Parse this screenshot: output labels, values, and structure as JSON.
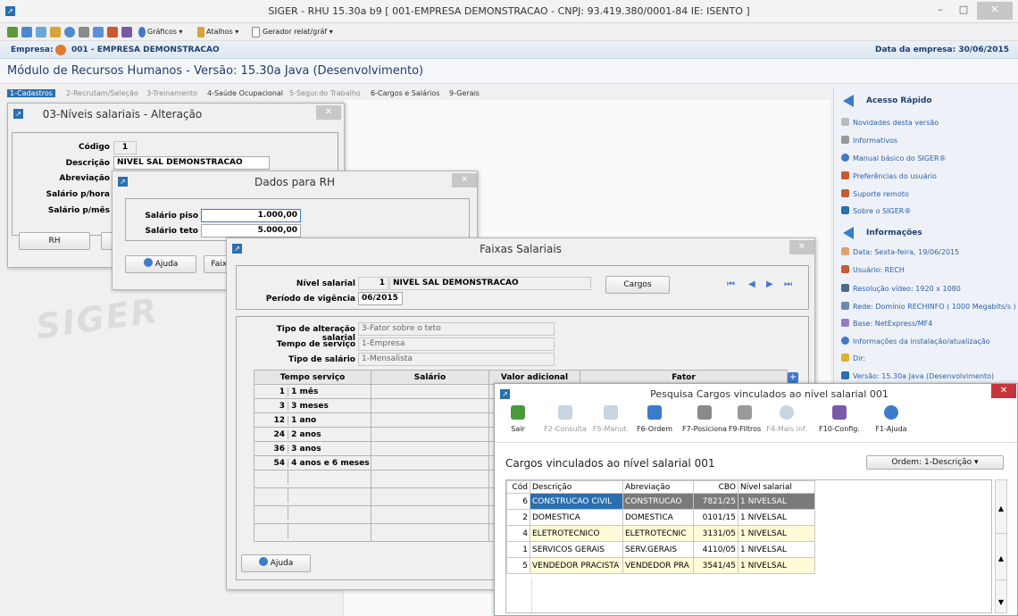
{
  "window": {
    "title": "SIGER - RHU 15.30a b9 [ 001-EMPRESA DEMONSTRACAO - CNPJ: 93.419.380/0001-84 IE: ISENTO ]",
    "minimize": "–",
    "maximize": "□",
    "close": "✕"
  },
  "toolbar": {
    "graficos": "Gráficos ▾",
    "atalhos": "Atalhos ▾",
    "gerador": "Gerador relat/gráf ▾"
  },
  "empresa": {
    "label": "Empresa:",
    "value": "001 - EMPRESA DEMONSTRACAO",
    "data_label": "Data da empresa: 30/06/2015"
  },
  "module": {
    "title": "Módulo de Recursos Humanos - Versão: 15.30a Java (Desenvolvimento)"
  },
  "menu": [
    "1-Cadastros",
    "2-Recrutam/Seleção",
    "3-Treinamento",
    "4-Saúde Ocupacional",
    "5-Segur.do Trabalho",
    "6-Cargos e Salários",
    "9-Gerais"
  ],
  "watermark": "SIGER",
  "niveis": {
    "title": "03-Níveis salariais - Alteração",
    "codigo_label": "Código",
    "codigo": "1",
    "descricao_label": "Descrição",
    "descricao": "NIVEL SAL DEMONSTRACAO",
    "abreviacao_label": "Abreviação",
    "salario_hora_label": "Salário p/hora",
    "salario_mes_label": "Salário p/mês",
    "rh_button": "RH"
  },
  "dadosrh": {
    "title": "Dados para RH",
    "piso_label": "Salário piso",
    "piso": "1.000,00",
    "teto_label": "Salário teto",
    "teto": "5.000,00",
    "ajuda": "Ajuda",
    "faixa": "Faixa"
  },
  "faixas": {
    "title": "Faixas Salariais",
    "nivel_label": "Nível salarial",
    "nivel_cod": "1",
    "nivel_desc": "NIVEL SAL DEMONSTRACAO",
    "cargos_button": "Cargos",
    "periodo_label": "Período de vigência",
    "periodo": "06/2015",
    "tipo_alt_label": "Tipo de alteração salarial",
    "tipo_alt": "3-Fator sobre o teto",
    "tempo_label": "Tempo de serviço",
    "tempo": "1-Empresa",
    "tipo_sal_label": "Tipo de salário",
    "tipo_sal": "1-Mensalista",
    "columns": [
      "Tempo serviço",
      "Salário",
      "Valor adicional",
      "Fator"
    ],
    "rows": [
      {
        "n": "1",
        "d": "1 mês"
      },
      {
        "n": "3",
        "d": "3 meses"
      },
      {
        "n": "12",
        "d": "1 ano"
      },
      {
        "n": "24",
        "d": "2 anos"
      },
      {
        "n": "36",
        "d": "3 anos"
      },
      {
        "n": "54",
        "d": "4 anos e 6 meses"
      }
    ],
    "ajuda": "Ajuda",
    "nav": [
      "⏮",
      "◀",
      "▶",
      "⏭"
    ],
    "add": "+"
  },
  "rapido": {
    "head1": "Acesso Rápido",
    "items1": [
      "Novidades desta versão",
      "Informativos",
      "Manual básico do SIGER®",
      "Preferências do usuário",
      "Suporte remoto",
      "Sobre o SIGER®"
    ],
    "head2": "Informações",
    "items2": [
      "Data: Sexta-feira, 19/06/2015",
      "Usuário: RECH",
      "Resolução vídeo: 1920 x 1080",
      "Rede: Domínio RECHINFO ( 1000 Megabits/s )",
      "Base: NetExpress/MF4",
      "Informações da instalação/atualização",
      "Dir:",
      "Versão: 15.30a Java (Desenvolvimento)"
    ]
  },
  "pesquisa": {
    "title": "Pesquisa Cargos vinculados ao nível salarial 001",
    "heading": "Cargos vinculados ao nível salarial 001",
    "ordem": "Ordem: 1-Descrição ▾",
    "tools": [
      "Sair",
      "F2-Consulta",
      "F5-Manut.",
      "F6-Ordem",
      "F7-Posiciona",
      "F9-Filtros",
      "F4-Mais inf.",
      "F10-Config.",
      "F1-Ajuda"
    ],
    "columns": [
      "Cód",
      "Descrição",
      "Abreviação",
      "CBO",
      "Nível salarial"
    ],
    "rows": [
      {
        "c": "6",
        "d": "CONSTRUCAO CIVIL",
        "a": "CONSTRUCAO",
        "cbo": "7821/25",
        "n": "1 NIVELSAL"
      },
      {
        "c": "2",
        "d": "DOMESTICA",
        "a": "DOMESTICA",
        "cbo": "0101/15",
        "n": "1 NIVELSAL"
      },
      {
        "c": "4",
        "d": "ELETROTECNICO",
        "a": "ELETROTECNIC",
        "cbo": "3131/05",
        "n": "1 NIVELSAL"
      },
      {
        "c": "1",
        "d": "SERVICOS GERAIS",
        "a": "SERV.GERAIS",
        "cbo": "4110/05",
        "n": "1 NIVELSAL"
      },
      {
        "c": "5",
        "d": "VENDEDOR PRACISTA",
        "a": "VENDEDOR PRA",
        "cbo": "3541/45",
        "n": "1 NIVELSAL"
      }
    ]
  }
}
